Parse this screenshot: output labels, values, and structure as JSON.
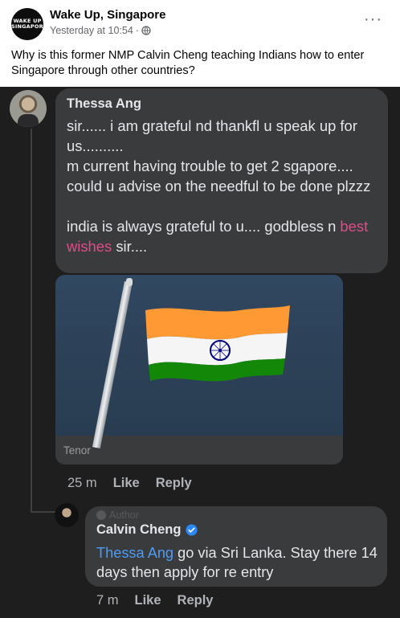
{
  "post": {
    "page_name": "Wake Up, Singapore",
    "avatar_text_line1": "WAKE UP",
    "avatar_text_line2": "SINGAPORE",
    "timestamp": "Yesterday at 10:54",
    "separator": "·",
    "privacy_icon": "globe-icon",
    "more_label": "···",
    "text": "Why is this former NMP Calvin Cheng teaching Indians how to enter Singapore through other countries?"
  },
  "comments": [
    {
      "author": "Thessa Ang",
      "text_main": "sir...... i am grateful nd thankfl u speak up for us..........\nm current having trouble to get 2 sgapore.... could u advise on the needful to be done plzzz\n\nindia is always grateful to u.... godbless n ",
      "text_tag": "best wishes",
      "text_tail": " sir....",
      "gif_caption": "Tenor",
      "time": "25 m",
      "like_label": "Like",
      "reply_label": "Reply"
    },
    {
      "badge": "Author",
      "author": "Calvin Cheng",
      "verified_icon": "verified-badge-icon",
      "mention": "Thessa Ang",
      "text": " go via Sri Lanka. Stay there 14 days then apply for re entry",
      "time": "7 m",
      "like_label": "Like",
      "reply_label": "Reply"
    }
  ],
  "colors": {
    "dark_bg": "#1e1e1f",
    "bubble": "#3a3b3c",
    "tag_pink": "#e04b8c",
    "mention_blue": "#4b9cf5",
    "flag_saffron": "#ff9933",
    "flag_green": "#138808",
    "chakra_navy": "#000080"
  }
}
